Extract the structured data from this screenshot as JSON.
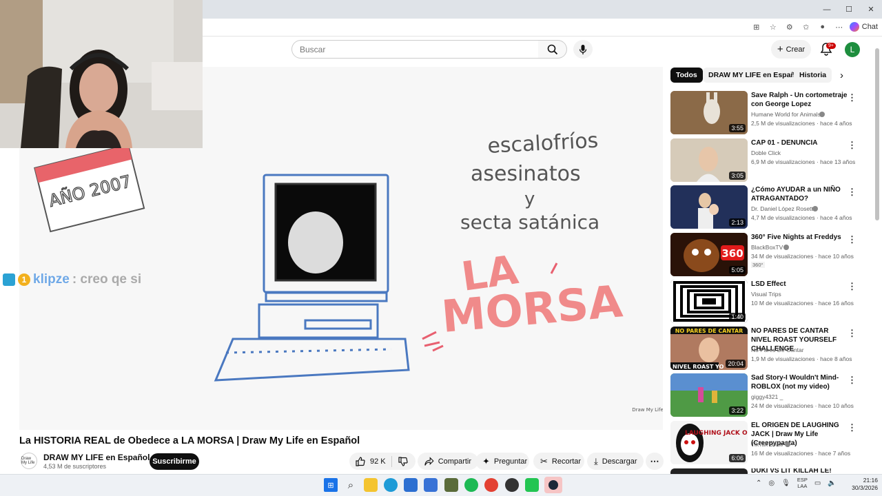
{
  "browser": {
    "window_controls": [
      "—",
      "☐",
      "✕"
    ],
    "copilot_label": "Chat"
  },
  "header": {
    "search_placeholder": "Buscar",
    "create_label": "Crear",
    "notifications_badge": "9+",
    "avatar_letter": "L"
  },
  "video": {
    "handwriting": {
      "date_card": "AÑO 2007",
      "line1": "escalofríos",
      "line2": "asesinatos",
      "line3": "y",
      "line4": "secta satánica",
      "big1": "LA",
      "big2": "MORSA"
    },
    "watermark": "Draw My Life",
    "chat_overlay": {
      "badge2": "1",
      "user": "klipze",
      "message": ": creo qe si"
    }
  },
  "below": {
    "title": "La HISTORIA REAL de Obedece a LA MORSA | Draw My Life en Español",
    "channel_logo": "Draw My Life",
    "channel": "DRAW MY LIFE en Español",
    "subscribers": "4,53 M de suscriptores",
    "subscribe_label": "Suscribirme",
    "likes": "92 K",
    "share": "Compartir",
    "ask": "Preguntar",
    "clip": "Recortar",
    "download": "Descargar"
  },
  "chips": [
    "Todos",
    "DRAW MY LIFE en Español",
    "Historia"
  ],
  "recommendations": [
    {
      "title": "Save Ralph - Un cortometraje con George Lopez",
      "channel": "Humane World for Animals",
      "verified": true,
      "meta": "2,5 M de visualizaciones · hace 4 años",
      "duration": "3:55",
      "color": "#7a5a3a"
    },
    {
      "title": "CAP 01 - DENUNCIA",
      "channel": "Doble Click",
      "verified": false,
      "meta": "6,9 M de visualizaciones · hace 13 años",
      "duration": "3:05",
      "color": "#c9b8a2"
    },
    {
      "title": "¿Cómo AYUDAR a un NIÑO ATRAGANTADO?",
      "channel": "Dr. Daniel López Rosetti",
      "verified": true,
      "meta": "4,7 M de visualizaciones · hace 4 años",
      "duration": "2:13",
      "color": "#2a3a66"
    },
    {
      "title": "360° Five Nights at Freddys",
      "channel": "BlackBoxTV",
      "verified": true,
      "meta": "34 M de visualizaciones · hace 10 años",
      "extra": "360°",
      "duration": "5:05",
      "color": "#3a1a0a"
    },
    {
      "title": "LSD Effect",
      "channel": "Visual Trips",
      "verified": false,
      "meta": "10 M de visualizaciones · hace 16 años",
      "duration": "1:40",
      "color": "#111111"
    },
    {
      "title": "NO PARES DE CANTAR  NIVEL ROAST YOURSELF CHALLENGE",
      "channel": "No Pares De Cantar",
      "verified": false,
      "meta": "1,9 M de visualizaciones · hace 8 años",
      "duration": "20:04",
      "color": "#8a5a4a"
    },
    {
      "title": "Sad Story-I Wouldn't Mind-ROBLOX (not my video)",
      "channel": "giggy4321 _",
      "verified": false,
      "meta": "24 M de visualizaciones · hace 10 años",
      "duration": "3:22",
      "color": "#3f7f3a"
    },
    {
      "title": "EL ORIGEN DE LAUGHING JACK | Draw My Life (Creepypasta)",
      "channel": "TikTak Draw",
      "verified": true,
      "meta": "16 M de visualizaciones · hace 7 años",
      "duration": "6:06",
      "color": "#ffffff"
    }
  ],
  "thumb_text": {
    "freddy_badge": "360",
    "nopares_top": "NO PARES DE CANTAR",
    "nopares_bottom": "NIVEL ROAST YO",
    "jack": "LAUGHING JACK ORIGEN"
  },
  "partial_next_title": "DUKI VS LIT KILLAH LE!",
  "taskbar": {
    "lang_top": "ESP",
    "lang_bottom": "LAA",
    "time": "21:16",
    "date": "30/3/2026"
  }
}
